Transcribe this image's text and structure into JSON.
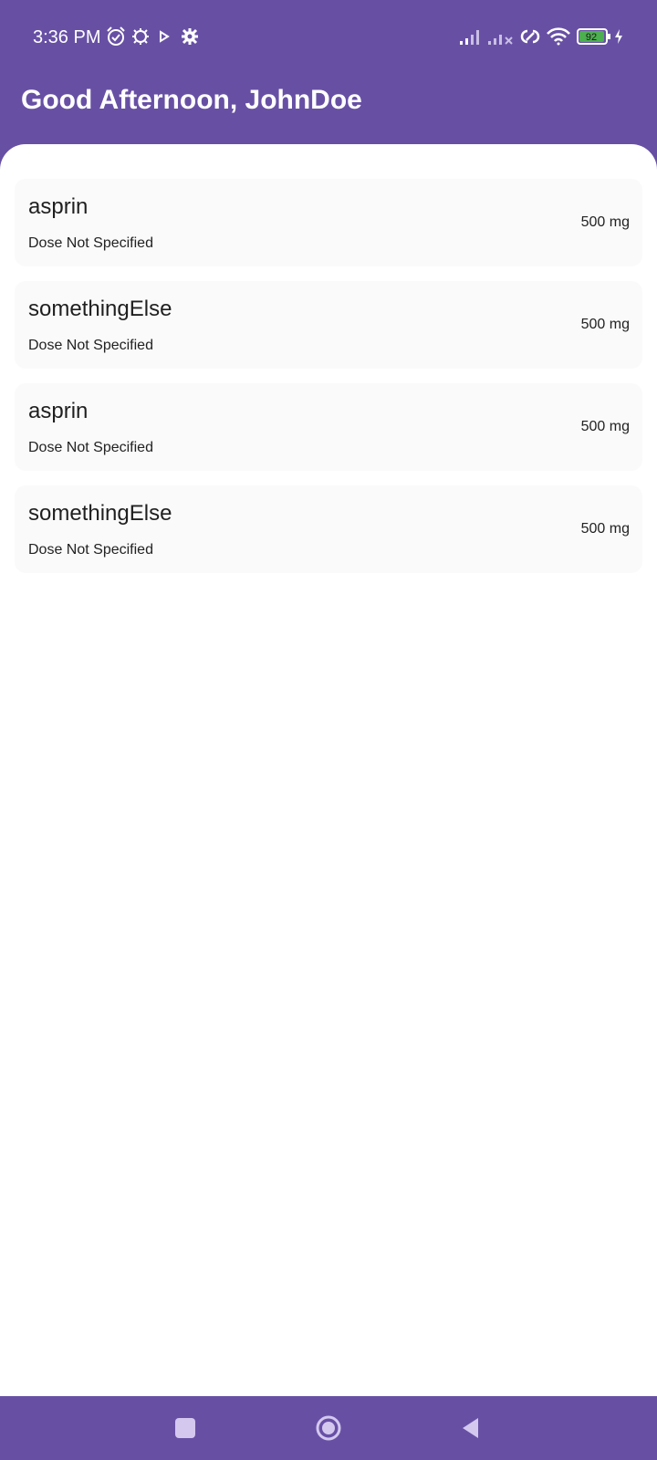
{
  "status_bar": {
    "time": "3:36 PM",
    "battery_level": "92",
    "icons": [
      "alarm-icon",
      "chip-icon",
      "play-icon",
      "settings-icon",
      "signal-icon",
      "signal-no-service-icon",
      "link-icon",
      "wifi-icon",
      "battery-icon",
      "charging-icon"
    ]
  },
  "header": {
    "greeting": "Good Afternoon, JohnDoe"
  },
  "medications": [
    {
      "name": "asprin",
      "dose_note": "Dose Not Specified",
      "amount": "500 mg"
    },
    {
      "name": "somethingElse",
      "dose_note": "Dose Not Specified",
      "amount": "500 mg"
    },
    {
      "name": "asprin",
      "dose_note": "Dose Not Specified",
      "amount": "500 mg"
    },
    {
      "name": "somethingElse",
      "dose_note": "Dose Not Specified",
      "amount": "500 mg"
    }
  ],
  "nav_bar": {
    "buttons": [
      "recents-icon",
      "home-icon",
      "back-icon"
    ]
  },
  "colors": {
    "primary": "#6750a4",
    "surface": "#ffffff",
    "card": "#fafafa",
    "battery_fill": "#4caf50",
    "nav_icon": "#d4c8ef"
  }
}
